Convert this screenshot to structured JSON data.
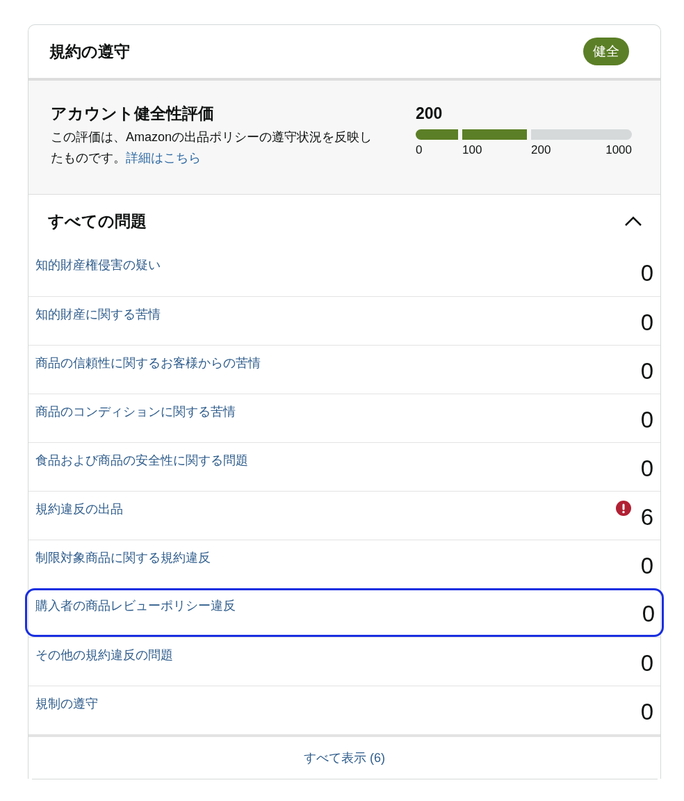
{
  "card": {
    "title": "規約の遵守",
    "status_badge": "健全"
  },
  "rating": {
    "title": "アカウント健全性評価",
    "description": "この評価は、Amazonの出品ポリシーの遵守状況を反映したものです。",
    "link": "詳細はこちら",
    "score": "200",
    "segments": [
      {
        "filled": true
      },
      {
        "filled": true
      },
      {
        "filled": false
      }
    ],
    "ticks": [
      "0",
      "100",
      "200",
      "1000"
    ]
  },
  "issues": {
    "title": "すべての問題",
    "expanded": true,
    "rows": [
      {
        "label": "知的財産権侵害の疑い",
        "count": "0",
        "alert": false,
        "selected": false
      },
      {
        "label": "知的財産に関する苦情",
        "count": "0",
        "alert": false,
        "selected": false
      },
      {
        "label": "商品の信頼性に関するお客様からの苦情",
        "count": "0",
        "alert": false,
        "selected": false
      },
      {
        "label": "商品のコンディションに関する苦情",
        "count": "0",
        "alert": false,
        "selected": false
      },
      {
        "label": "食品および商品の安全性に関する問題",
        "count": "0",
        "alert": false,
        "selected": false
      },
      {
        "label": "規約違反の出品",
        "count": "6",
        "alert": true,
        "selected": false
      },
      {
        "label": "制限対象商品に関する規約違反",
        "count": "0",
        "alert": false,
        "selected": false
      },
      {
        "label": "購入者の商品レビューポリシー違反",
        "count": "0",
        "alert": false,
        "selected": true
      },
      {
        "label": "その他の規約違反の問題",
        "count": "0",
        "alert": false,
        "selected": false
      },
      {
        "label": "規制の遵守",
        "count": "0",
        "alert": false,
        "selected": false
      }
    ]
  },
  "footer_link": "すべて表示 (6)"
}
